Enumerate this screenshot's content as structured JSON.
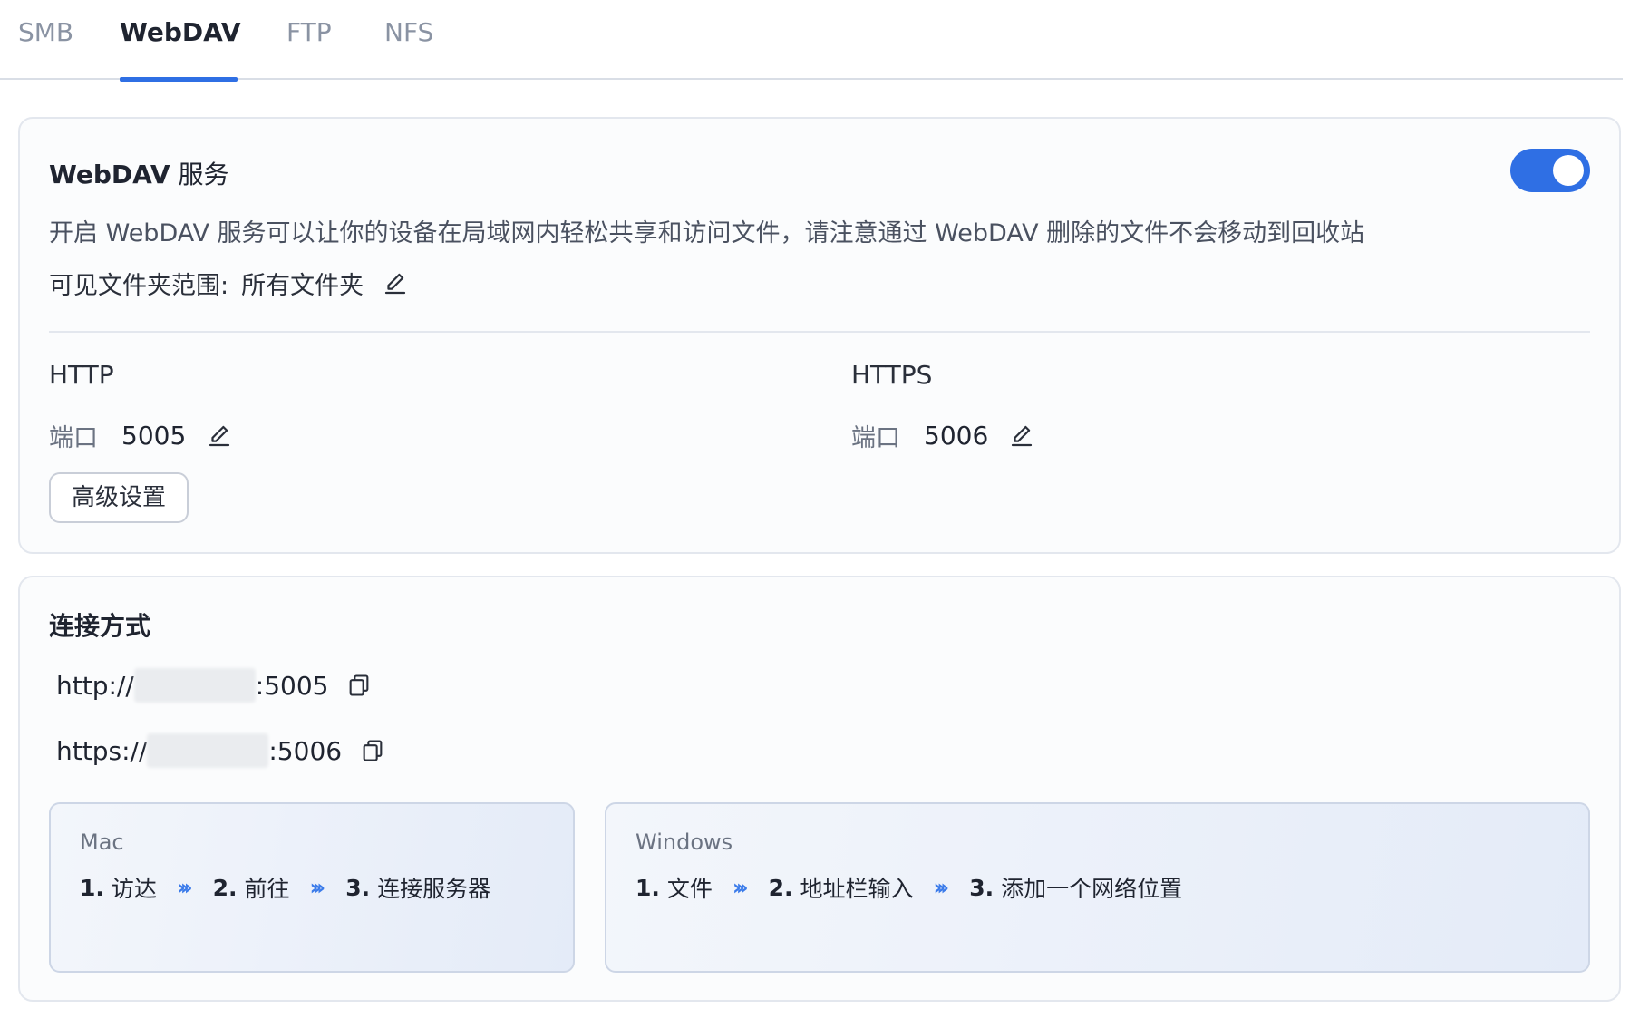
{
  "tabs": [
    {
      "label": "SMB"
    },
    {
      "label": "WebDAV"
    },
    {
      "label": "FTP"
    },
    {
      "label": "NFS"
    }
  ],
  "service": {
    "title_main": "WebDAV",
    "title_suffix": " 服务",
    "enabled": true,
    "description": "开启 WebDAV 服务可以让你的设备在局域网内轻松共享和访问文件，请注意通过 WebDAV 删除的文件不会移动到回收站",
    "scope_label": "可见文件夹范围:",
    "scope_value": "所有文件夹",
    "http": {
      "label": "HTTP",
      "port_label": "端口",
      "port": "5005"
    },
    "https": {
      "label": "HTTPS",
      "port_label": "端口",
      "port": "5006"
    },
    "advanced_button": "高级设置"
  },
  "connection": {
    "title": "连接方式",
    "http_prefix": "http://",
    "http_suffix": ":5005",
    "https_prefix": "https://",
    "https_suffix": ":5006",
    "mac": {
      "title": "Mac",
      "steps": [
        {
          "num": "1.",
          "text": "访达"
        },
        {
          "num": "2.",
          "text": "前往"
        },
        {
          "num": "3.",
          "text": "连接服务器"
        }
      ]
    },
    "windows": {
      "title": "Windows",
      "steps": [
        {
          "num": "1.",
          "text": "文件"
        },
        {
          "num": "2.",
          "text": "地址栏输入"
        },
        {
          "num": "3.",
          "text": "添加一个网络位置"
        }
      ]
    }
  },
  "colors": {
    "accent": "#2f6fe4",
    "chevron": "#3b7bea"
  }
}
